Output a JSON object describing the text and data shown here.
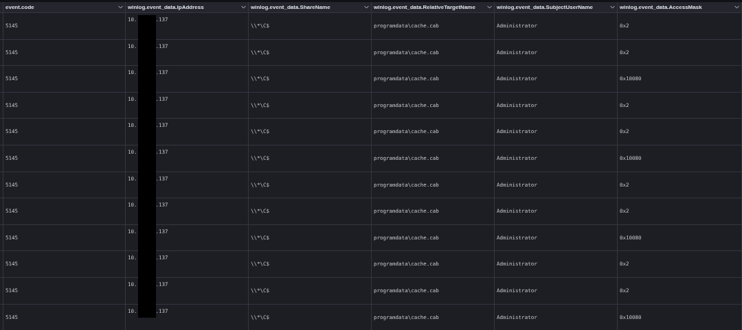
{
  "table": {
    "columns": [
      "event.code",
      "winlog.event_data.IpAddress",
      "winlog.event_data.ShareName",
      "winlog.event_data.RelativeTargetName",
      "winlog.event_data.SubjectUserName",
      "winlog.event_data.AccessMask"
    ],
    "rows": [
      {
        "code": "5145",
        "ip_prefix": "10.",
        "ip_suffix": ".137",
        "share": "\\\\*\\C$",
        "target": "programdata\\cache.cab",
        "user": "Administrator",
        "mask": "0x2"
      },
      {
        "code": "5145",
        "ip_prefix": "10.",
        "ip_suffix": ".137",
        "share": "\\\\*\\C$",
        "target": "programdata\\cache.cab",
        "user": "Administrator",
        "mask": "0x2"
      },
      {
        "code": "5145",
        "ip_prefix": "10.",
        "ip_suffix": ".137",
        "share": "\\\\*\\C$",
        "target": "programdata\\cache.cab",
        "user": "Administrator",
        "mask": "0x10080"
      },
      {
        "code": "5145",
        "ip_prefix": "10.",
        "ip_suffix": ".137",
        "share": "\\\\*\\C$",
        "target": "programdata\\cache.cab",
        "user": "Administrator",
        "mask": "0x2"
      },
      {
        "code": "5145",
        "ip_prefix": "10.",
        "ip_suffix": ".137",
        "share": "\\\\*\\C$",
        "target": "programdata\\cache.cab",
        "user": "Administrator",
        "mask": "0x2"
      },
      {
        "code": "5145",
        "ip_prefix": "10.",
        "ip_suffix": ".137",
        "share": "\\\\*\\C$",
        "target": "programdata\\cache.cab",
        "user": "Administrator",
        "mask": "0x10080"
      },
      {
        "code": "5145",
        "ip_prefix": "10.",
        "ip_suffix": ".137",
        "share": "\\\\*\\C$",
        "target": "programdata\\cache.cab",
        "user": "Administrator",
        "mask": "0x2"
      },
      {
        "code": "5145",
        "ip_prefix": "10.",
        "ip_suffix": ".137",
        "share": "\\\\*\\C$",
        "target": "programdata\\cache.cab",
        "user": "Administrator",
        "mask": "0x2"
      },
      {
        "code": "5145",
        "ip_prefix": "10.",
        "ip_suffix": ".137",
        "share": "\\\\*\\C$",
        "target": "programdata\\cache.cab",
        "user": "Administrator",
        "mask": "0x10080"
      },
      {
        "code": "5145",
        "ip_prefix": "10.",
        "ip_suffix": ".137",
        "share": "\\\\*\\C$",
        "target": "programdata\\cache.cab",
        "user": "Administrator",
        "mask": "0x2"
      },
      {
        "code": "5145",
        "ip_prefix": "10.",
        "ip_suffix": ".137",
        "share": "\\\\*\\C$",
        "target": "programdata\\cache.cab",
        "user": "Administrator",
        "mask": "0x2"
      },
      {
        "code": "5145",
        "ip_prefix": "10.",
        "ip_suffix": ".137",
        "share": "\\\\*\\C$",
        "target": "programdata\\cache.cab",
        "user": "Administrator",
        "mask": "0x10080"
      }
    ]
  }
}
